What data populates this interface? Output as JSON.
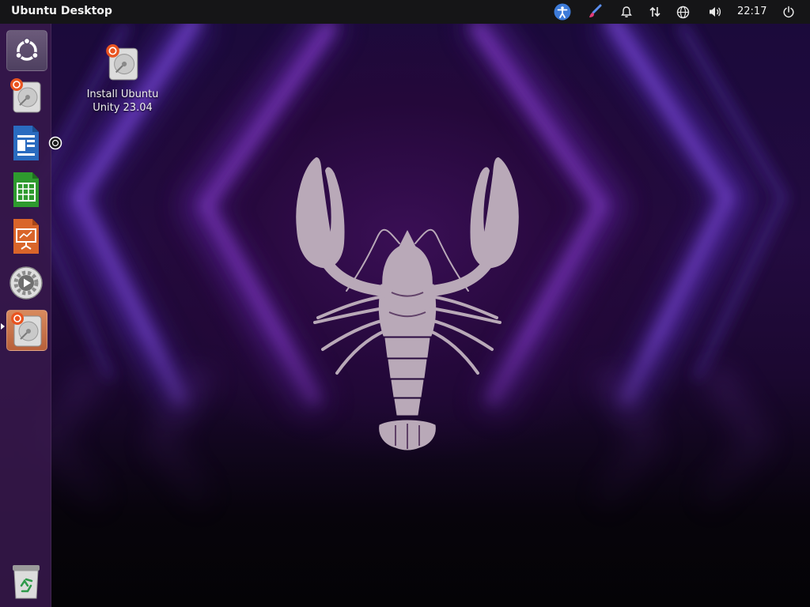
{
  "top_bar": {
    "title": "Ubuntu Desktop",
    "clock": "22:17",
    "indicators": [
      "accessibility-icon",
      "paintbrush-icon",
      "bell-icon",
      "network-icon",
      "globe-icon",
      "volume-icon",
      "power-icon"
    ]
  },
  "launcher": {
    "items": [
      {
        "name": "dash-home",
        "icon": "ubuntu-logo-icon"
      },
      {
        "name": "install-ubuntu",
        "icon": "installer-disk-icon"
      },
      {
        "name": "libreoffice-writer",
        "icon": "writer-icon"
      },
      {
        "name": "libreoffice-calc",
        "icon": "calc-icon"
      },
      {
        "name": "libreoffice-impress",
        "icon": "impress-icon"
      },
      {
        "name": "settings",
        "icon": "gear-play-icon"
      },
      {
        "name": "install-ubuntu-running",
        "icon": "installer-disk-icon"
      },
      {
        "name": "trash",
        "icon": "trash-icon"
      }
    ]
  },
  "desktop": {
    "icons": [
      {
        "label": "Install Ubuntu\nUnity 23.04",
        "icon": "installer-disk-icon"
      }
    ]
  },
  "colors": {
    "top_bar": "#151517",
    "launcher": "#37184b",
    "accent_orange": "#e95420",
    "wallpaper_purple": "#3a0f55"
  }
}
